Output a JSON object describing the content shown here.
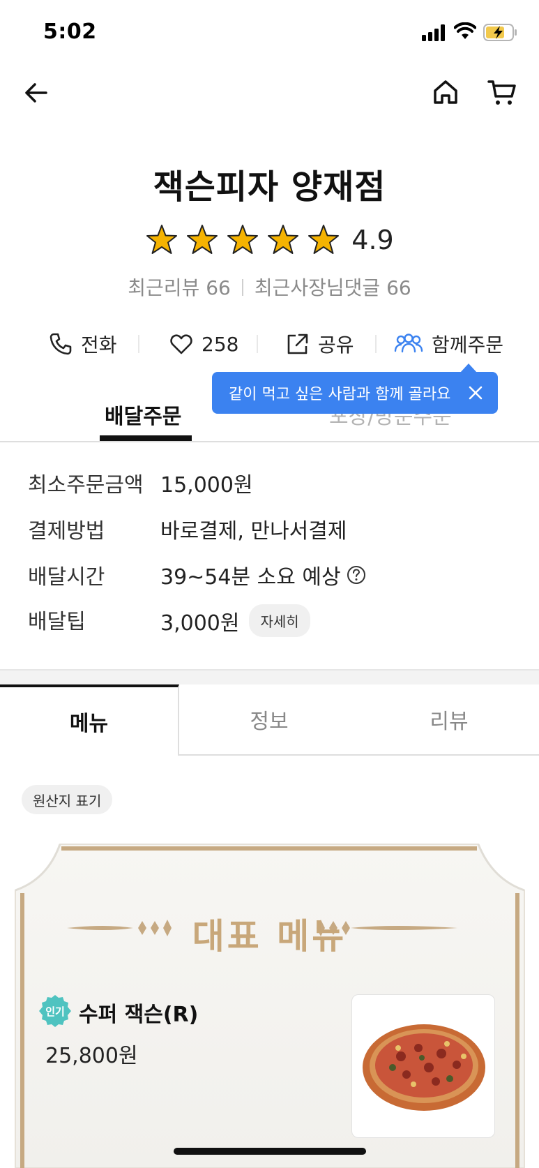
{
  "status": {
    "time": "5:02"
  },
  "store": {
    "title": "잭슨피자 양재점",
    "rating": "4.9",
    "stars": 5,
    "recent_reviews": "최근리뷰 66",
    "owner_comments": "최근사장님댓글 66"
  },
  "actions": {
    "call": "전화",
    "likes": "258",
    "share": "공유",
    "group_order": "함께주문"
  },
  "tooltip": {
    "text": "같이 먹고 싶은 사람과 함께 골라요"
  },
  "order_tabs": {
    "delivery": "배달주문",
    "pickup": "포장/방문주문"
  },
  "info": {
    "min_order_label": "최소주문금액",
    "min_order_value": "15,000원",
    "payment_label": "결제방법",
    "payment_value": "바로결제, 만나서결제",
    "time_label": "배달시간",
    "time_value": "39~54분 소요 예상",
    "tip_label": "배달팁",
    "tip_value": "3,000원",
    "tip_detail": "자세히"
  },
  "menu_tabs": {
    "menu": "메뉴",
    "info": "정보",
    "review": "리뷰"
  },
  "origin_label": "원산지 표기",
  "featured": {
    "title": "대표 메뉴",
    "item": {
      "badge": "인기",
      "name": "수퍼 잭슨(R)",
      "price": "25,800원"
    }
  },
  "colors": {
    "accent": "#3b82f0",
    "star": "#f5b301",
    "gold": "#c8a77a",
    "badge": "#4fc3c0"
  }
}
